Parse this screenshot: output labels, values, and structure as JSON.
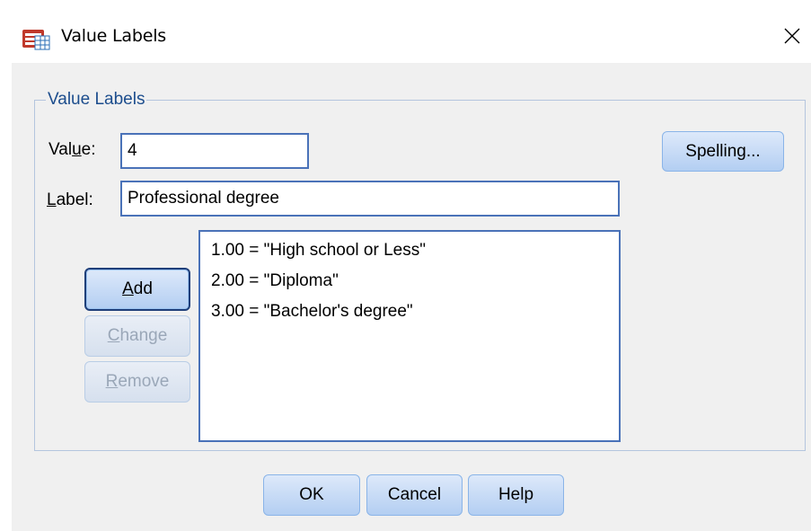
{
  "window": {
    "title": "Value Labels",
    "icon": "spss-value-labels-icon",
    "close_glyph": "✕"
  },
  "group": {
    "legend": "Value Labels"
  },
  "value_field": {
    "label_before": "Val",
    "label_mnemonic": "u",
    "label_after": "e:",
    "value": "4"
  },
  "label_field": {
    "label_mnemonic": "L",
    "label_after": "abel:",
    "value": "Professional degree"
  },
  "spelling_button": {
    "label": "Spelling..."
  },
  "add_button": {
    "mnemonic": "A",
    "rest": "dd"
  },
  "change_button": {
    "mnemonic": "C",
    "rest": "hange"
  },
  "remove_button": {
    "mnemonic": "R",
    "rest": "emove"
  },
  "value_list": {
    "items": [
      "1.00 = \"High school or Less\"",
      "2.00 = \"Diploma\"",
      "3.00 = \"Bachelor's degree\""
    ]
  },
  "footer": {
    "ok_label": "OK",
    "cancel_label": "Cancel",
    "help_label": "Help"
  },
  "colors": {
    "legend_text": "#1c4d8d",
    "button_face": "#c9dcf6",
    "field_border": "#4a72b8",
    "dialog_bg": "#f0f0f0"
  }
}
